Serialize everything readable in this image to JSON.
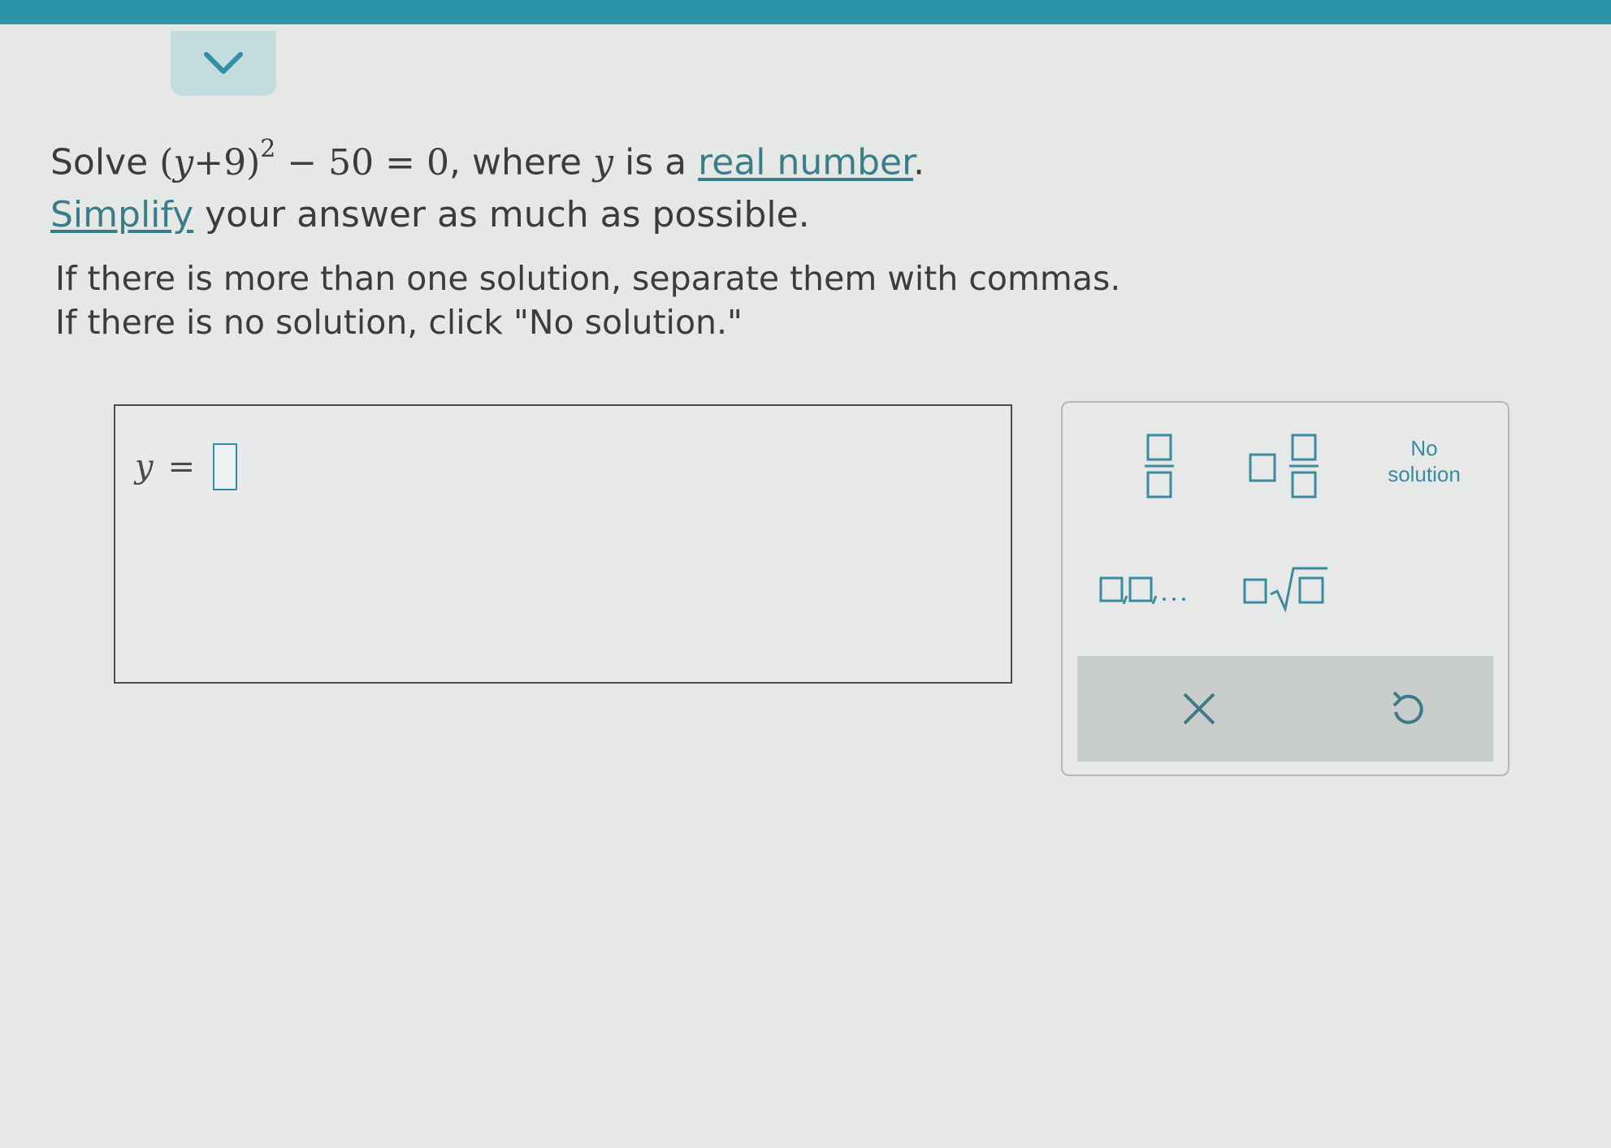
{
  "problem": {
    "solve_word": "Solve",
    "equation": "(y+9)² − 50 = 0",
    "where_text": ", where",
    "variable": "y",
    "is_a_text": "is a",
    "real_number_link": "real number",
    "period": ".",
    "simplify_link": "Simplify",
    "simplify_rest": " your answer as much as possible."
  },
  "instructions": {
    "line1": "If there is more than one solution, separate them with commas.",
    "line2": "If there is no solution, click \"No solution.\""
  },
  "answer": {
    "variable": "y",
    "equals": "=",
    "value": ""
  },
  "keypad": {
    "no_solution_line1": "No",
    "no_solution_line2": "solution",
    "buttons": [
      "fraction",
      "mixed-number",
      "no-solution",
      "list",
      "nth-root",
      "clear",
      "undo"
    ]
  },
  "colors": {
    "top_bar": "#2a95a8",
    "accent": "#3a8ba0",
    "slot_border": "#2f8fa8"
  }
}
